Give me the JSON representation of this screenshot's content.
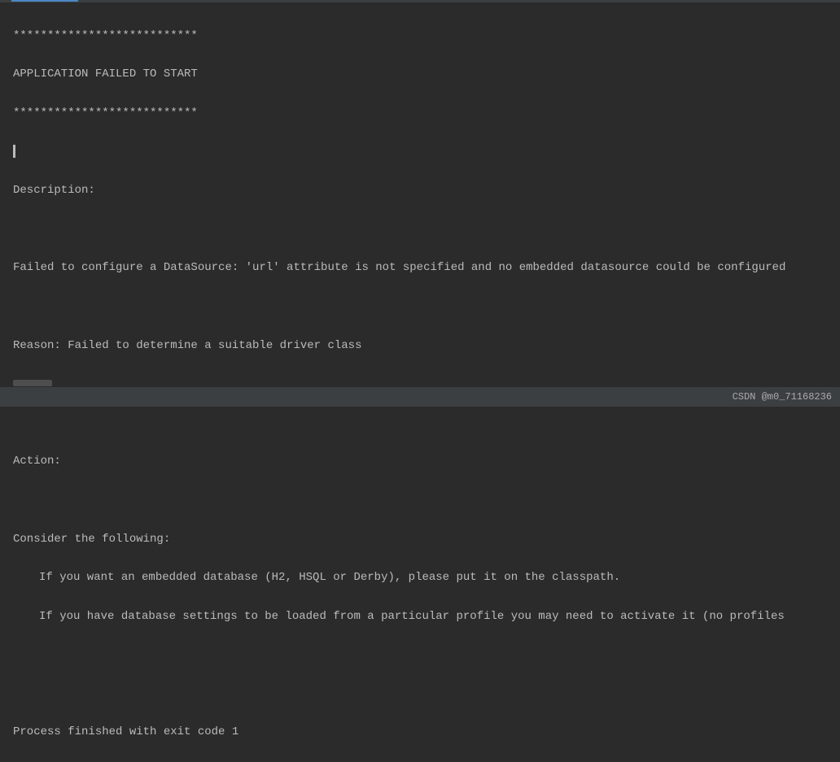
{
  "console": {
    "border_top": "***************************",
    "title": "APPLICATION FAILED TO START",
    "border_bottom": "***************************",
    "description_label": "Description:",
    "description_text": "Failed to configure a DataSource: 'url' attribute is not specified and no embedded datasource could be configured",
    "reason_text": "Reason: Failed to determine a suitable driver class",
    "action_label": "Action:",
    "consider_label": "Consider the following:",
    "suggestion_1": "If you want an embedded database (H2, HSQL or Derby), please put it on the classpath.",
    "suggestion_2": "If you have database settings to be loaded from a particular profile you may need to activate it (no profiles",
    "exit_message": "Process finished with exit code 1"
  },
  "statusbar": {
    "watermark": "CSDN @m0_71168236"
  }
}
